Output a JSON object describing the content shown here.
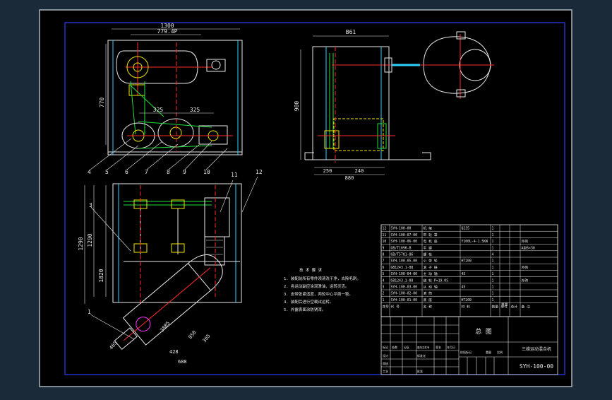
{
  "colors": {
    "window_bg": "#1b2a38",
    "sheet_bg": "#000000",
    "sheet_border": "#a9b3bd",
    "frame_line": "#2a3cff",
    "text_white": "#e8e8e8",
    "yellow": "#f2e600",
    "green": "#22e03a",
    "red": "#ff2a2a",
    "cyan": "#2ad4ff",
    "magenta": "#ff3cff"
  },
  "dims": {
    "front_width": "1300",
    "front_sub": "779.4P",
    "front_height": "770",
    "pulley_span_a": "325",
    "pulley_span_b": "325",
    "side_width": "B61",
    "side_height": "900",
    "side_base_a": "250",
    "side_base_b": "240",
    "side_base_total": "880",
    "plan_height_a": "1290",
    "plan_height_b": "1290",
    "plan_height_c": "1820",
    "arm_len_a": "465",
    "arm_len_b": "428",
    "arm_len_c": "688",
    "arm_len_d": "3885",
    "arm_len_e": "850",
    "arm_len_f": "365"
  },
  "balloons": [
    "4",
    "5",
    "6",
    "7",
    "8",
    "9",
    "10",
    "11",
    "12",
    "3",
    "1"
  ],
  "notes": {
    "title": "技 术 要 求",
    "lines": [
      "1. 装配前所有零件须清洗干净，去除毛刺。",
      "2. 各运动副应涂润滑油，运转灵活。",
      "3. 皮带张紧适度，两轮中心平面一致。",
      "4. 装配后进行空载试运转。",
      "5. 外露表面涂防锈漆。"
    ]
  },
  "bom": {
    "rows": [
      {
        "no": "12",
        "code": "SYH-100-00",
        "name": "机 架",
        "qty": "1",
        "material": "Q235",
        "mass": "",
        "note": ""
      },
      {
        "no": "11",
        "code": "SYH-100-07-00",
        "name": "带 轮 罩",
        "qty": "1",
        "material": "",
        "mass": "",
        "note": ""
      },
      {
        "no": "10",
        "code": "SYH-100-06-00",
        "name": "电 机 座",
        "qty": "1",
        "material": "Y100L-4-1.5KW",
        "mass": "",
        "note": "外购"
      },
      {
        "no": "9",
        "code": "GB/T1096-B",
        "name": "平 键",
        "qty": "1",
        "material": "",
        "mass": "",
        "note": "A型6×30"
      },
      {
        "no": "8",
        "code": "GB/T5781-86",
        "name": "螺 栓",
        "qty": "4",
        "material": "",
        "mass": "",
        "note": ""
      },
      {
        "no": "7",
        "code": "SYH-100-05-00",
        "name": "小 带 轮",
        "qty": "1",
        "material": "HT200",
        "mass": "",
        "note": ""
      },
      {
        "no": "6",
        "code": "GB1243.1-88",
        "name": "滚 子 链",
        "qty": "1",
        "material": "",
        "mass": "",
        "note": "外购"
      },
      {
        "no": "5",
        "code": "SYH-100-04-00",
        "name": "主 动 轴",
        "qty": "1",
        "material": "45",
        "mass": "",
        "note": ""
      },
      {
        "no": "4",
        "code": "GB1243.1-88",
        "name": "链 轮 P=19.05",
        "qty": "1",
        "material": "",
        "mass": "",
        "note": "外购"
      },
      {
        "no": "3",
        "code": "SYH-100-03-00",
        "name": "从 动 轴",
        "qty": "1",
        "material": "45",
        "mass": "",
        "note": ""
      },
      {
        "no": "2",
        "code": "SYH-100-02-00",
        "name": "滚 筒",
        "qty": "1",
        "material": "",
        "mass": "",
        "note": ""
      },
      {
        "no": "1",
        "code": "SYH-100-01-00",
        "name": "底 座",
        "qty": "1",
        "material": "HT200",
        "mass": "",
        "note": ""
      }
    ],
    "header": {
      "no": "序号",
      "code": "代 号",
      "name": "名 称",
      "qty": "数量",
      "material": "材 料",
      "mass_single": "单件",
      "mass_total": "总计",
      "mass": "重量",
      "note": "备 注"
    }
  },
  "title_block": {
    "drawing_name": "总 图",
    "machine_name": "三维运动混合机",
    "drawing_no": "SYH-100-00",
    "rows": [
      "标记",
      "处数",
      "分区",
      "更改文件号",
      "签名",
      "年月日"
    ],
    "roles": [
      "设计",
      "审核",
      "工艺",
      "批准"
    ],
    "std": "标准化",
    "stage": "阶段标记",
    "weight": "重量",
    "scale": "比例",
    "sheet": "共 张 第 张"
  }
}
